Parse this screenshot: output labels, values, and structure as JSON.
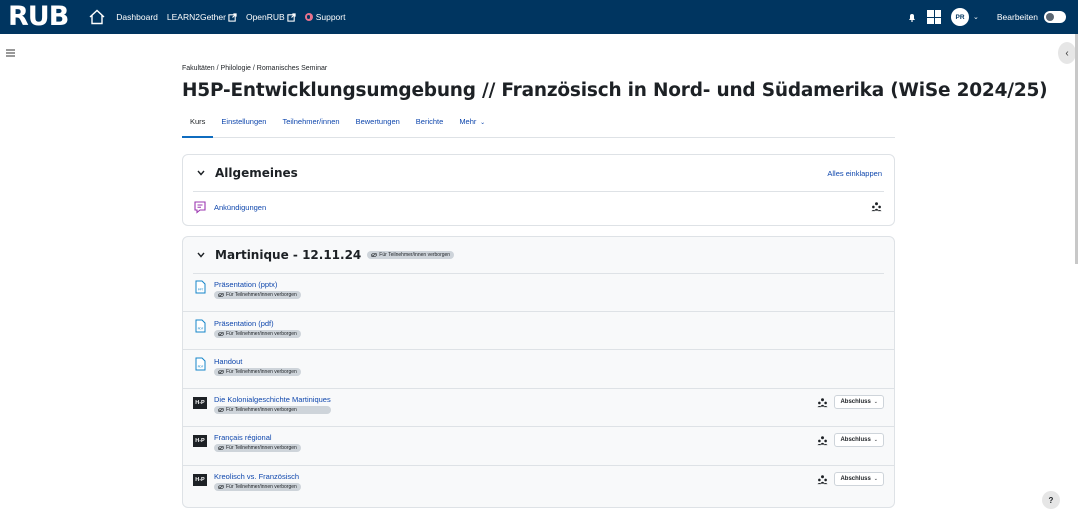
{
  "navbar": {
    "logo": "RUB",
    "links": [
      {
        "label": "Dashboard"
      },
      {
        "label": "LEARN2Gether"
      },
      {
        "label": "OpenRUB"
      },
      {
        "label": "Support"
      }
    ],
    "avatar_initials": "PR",
    "edit_mode_label": "Bearbeiten",
    "edit_mode_on": false
  },
  "breadcrumb": [
    "Fakultäten",
    "Philologie",
    "Romanisches Seminar"
  ],
  "breadcrumb_sep": "/",
  "page_title": "H5P-Entwicklungsumgebung // Französisch in Nord- und Südamerika (WiSe 2024/25)",
  "tabs": [
    {
      "label": "Kurs",
      "active": true
    },
    {
      "label": "Einstellungen"
    },
    {
      "label": "Teilnehmer/innen"
    },
    {
      "label": "Bewertungen"
    },
    {
      "label": "Berichte"
    },
    {
      "label": "Mehr"
    }
  ],
  "sections": [
    {
      "title": "Allgemeines",
      "collapse_all_label": "Alles einklappen",
      "activities": [
        {
          "name": "Ankündigungen",
          "icon": "forum-icon"
        }
      ]
    },
    {
      "title": "Martinique - 12.11.24",
      "hidden_label": "Für Teilnehmer/innen verborgen",
      "activities": [
        {
          "name": "Präsentation (pptx)",
          "icon": "pptx-icon",
          "hidden_label": "Für Teilnehmer/innen verborgen"
        },
        {
          "name": "Präsentation (pdf)",
          "icon": "pdf-icon",
          "hidden_label": "Für Teilnehmer/innen verborgen"
        },
        {
          "name": "Handout",
          "icon": "pdf-icon",
          "hidden_label": "Für Teilnehmer/innen verborgen"
        },
        {
          "name": "Die Kolonialgeschichte Martiniques",
          "icon": "h5p-icon",
          "hidden_label": "Für Teilnehmer/innen verborgen",
          "completion_label": "Abschluss"
        },
        {
          "name": "Français régional",
          "icon": "h5p-icon",
          "hidden_label": "Für Teilnehmer/innen verborgen",
          "completion_label": "Abschluss"
        },
        {
          "name": "Kreolisch vs. Französisch",
          "icon": "h5p-icon",
          "hidden_label": "Für Teilnehmer/innen verborgen",
          "completion_label": "Abschluss"
        }
      ]
    }
  ],
  "h5p_logo_text": "H-P",
  "pptx_badge": "PPT",
  "pdf_badge": "PDF",
  "help_label": "?",
  "colors": {
    "navbar": "#003560",
    "link": "#0f47ad",
    "active_tab_border": "#0f6cbf",
    "forum": "#9b37b0",
    "file": "#1485c9"
  }
}
